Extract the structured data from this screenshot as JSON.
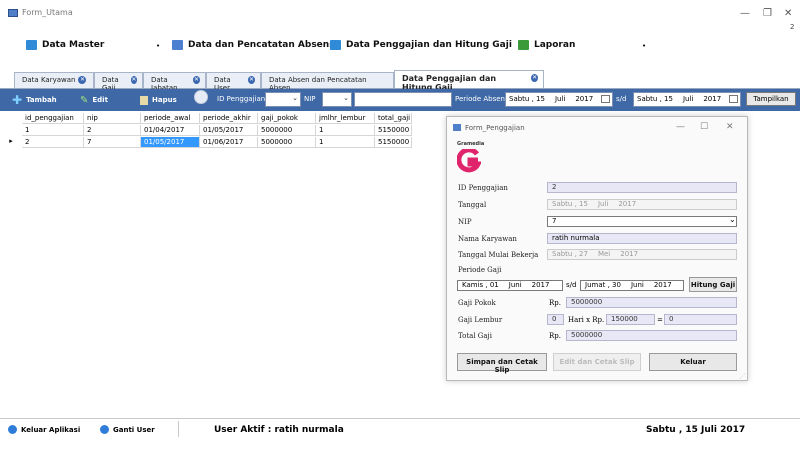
{
  "window": {
    "title": "Form_Utama",
    "side_number": "2"
  },
  "menu": [
    {
      "label": "Data Master"
    },
    {
      "label": "Data dan Pencatatan Absensi"
    },
    {
      "label": "Data Penggajian dan Hitung Gaji"
    },
    {
      "label": "Laporan"
    }
  ],
  "tabs": [
    {
      "label": "Data Karyawan"
    },
    {
      "label": "Data Gaji"
    },
    {
      "label": "Data Jabatan"
    },
    {
      "label": "Data User"
    },
    {
      "label": "Data Absen dan Pencatatan Absen"
    },
    {
      "label": "Data Penggajian dan Hitung Gaji"
    }
  ],
  "toolbar": {
    "tambah": "Tambah",
    "edit": "Edit",
    "hapus": "Hapus",
    "id_label": "ID Penggajian",
    "nip_label": "NIP",
    "periode_label": "Periode Absen",
    "date_from": {
      "day": "Sabtu , 15",
      "month": "Juli",
      "year": "2017"
    },
    "sd": "s/d",
    "date_to": {
      "day": "Sabtu , 15",
      "month": "Juli",
      "year": "2017"
    },
    "tampilkan": "Tampilkan"
  },
  "grid": {
    "columns": [
      "id_penggajian",
      "nip",
      "periode_awal",
      "periode_akhir",
      "gaji_pokok",
      "jmlhr_lembur",
      "total_gaji"
    ],
    "rows": [
      [
        "1",
        "2",
        "01/04/2017",
        "01/05/2017",
        "5000000",
        "1",
        "5150000"
      ],
      [
        "2",
        "7",
        "01/05/2017",
        "01/06/2017",
        "5000000",
        "1",
        "5150000"
      ]
    ],
    "current_row_marker": "▸"
  },
  "status": {
    "keluar": "Keluar Aplikasi",
    "ganti": "Ganti User",
    "user_aktif": "User Aktif : ratih nurmala",
    "tanggal": "Sabtu , 15 Juli 2017"
  },
  "dialog": {
    "title": "Form_Penggajian",
    "logo_text": "Gramedia",
    "fields": {
      "id_label": "ID Penggajian",
      "id_value": "2",
      "tanggal_label": "Tanggal",
      "tanggal": {
        "day": "Sabtu , 15",
        "month": "Juli",
        "year": "2017"
      },
      "nip_label": "NIP",
      "nip_value": "7",
      "nama_label": "Nama Karyawan",
      "nama_value": "ratih nurmala",
      "mulai_label": "Tanggal Mulai Bekerja",
      "mulai": {
        "day": "Sabtu , 27",
        "month": "Mei",
        "year": "2017"
      },
      "periode_label": "Periode Gaji",
      "periode_from": {
        "day": "Kamis , 01",
        "month": "Juni",
        "year": "2017"
      },
      "periode_sd": "s/d",
      "periode_to": {
        "day": "Jumat , 30",
        "month": "Juni",
        "year": "2017"
      },
      "hitung": "Hitung Gaji",
      "pokok_label": "Gaji Pokok",
      "pokok_rp": "Rp.",
      "pokok_value": "5000000",
      "lembur_label": "Gaji Lembur",
      "lembur_hari": "0",
      "lembur_hari_x": "Hari x Rp.",
      "lembur_rate": "150000",
      "lembur_eq": "=",
      "lembur_total": "0",
      "total_label": "Total Gaji",
      "total_rp": "Rp.",
      "total_value": "5000000"
    },
    "buttons": {
      "simpan": "Simpan dan Cetak Slip",
      "edit": "Edit dan Cetak Slip",
      "keluar": "Keluar"
    }
  },
  "colors": {
    "toolbar": "#3f69a6",
    "selection": "#3399ff",
    "logo": "#e0246c"
  }
}
